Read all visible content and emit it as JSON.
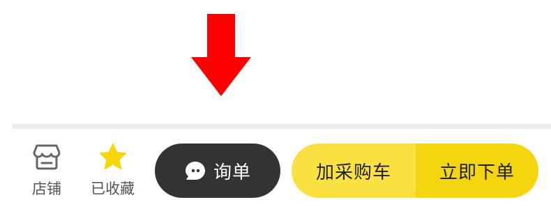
{
  "bottom_bar": {
    "store": {
      "label": "店铺",
      "icon": "store-icon"
    },
    "favorite": {
      "label": "已收藏",
      "icon": "star-icon",
      "icon_color": "#f7d507"
    },
    "inquiry_button": {
      "label": "询单",
      "icon": "chat-bubble-icon",
      "bg_color": "#333333"
    },
    "add_to_cart_button": {
      "label": "加采购车",
      "bg_color": "#fbe042"
    },
    "order_button": {
      "label": "立即下单",
      "bg_color": "#f3d60f"
    }
  },
  "annotation": {
    "icon": "down-arrow-icon",
    "color": "#ff0000"
  }
}
